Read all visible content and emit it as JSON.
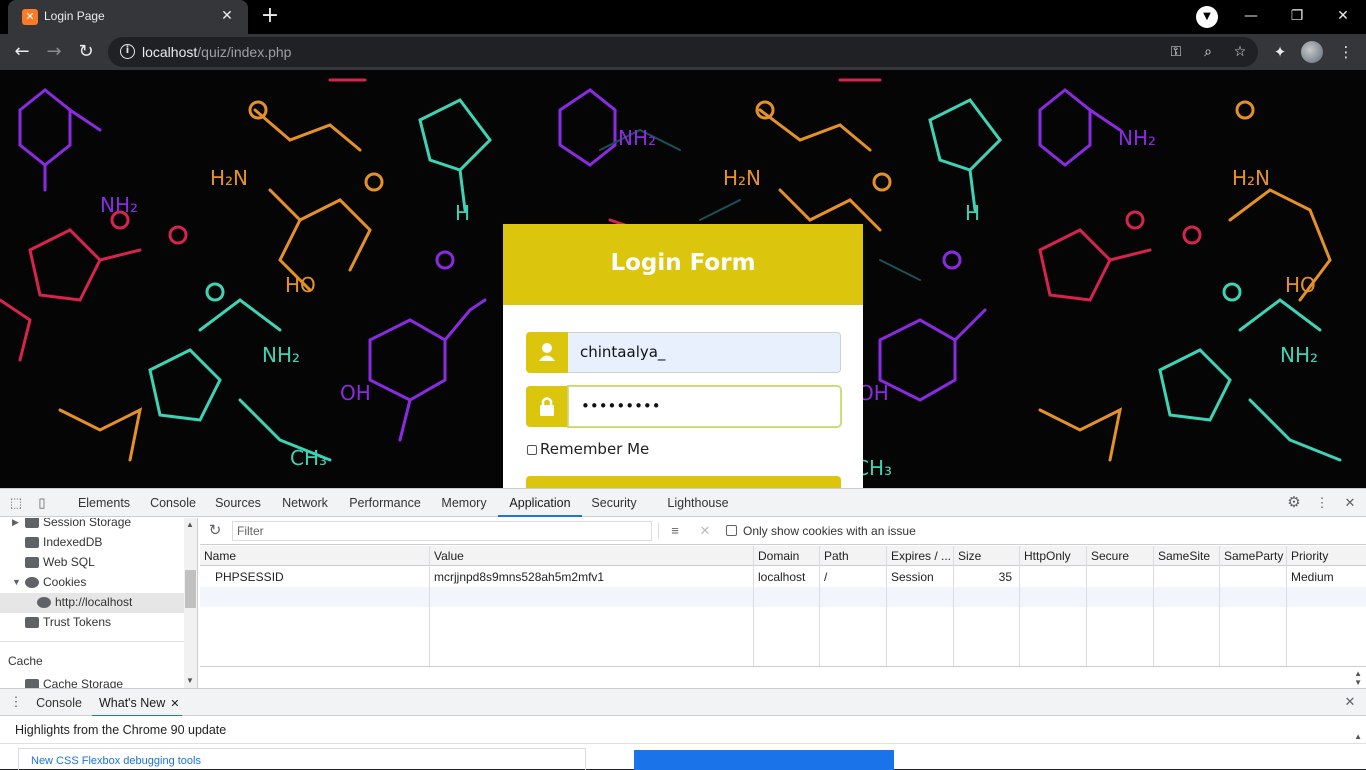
{
  "browser": {
    "tab_title": "Login Page",
    "tab_favicon_letter": "x",
    "url_host": "localhost",
    "url_path": "/quiz/index.php"
  },
  "page": {
    "login_title": "Login Form",
    "username_value": "chintaalya_",
    "password_value": "•••••••••",
    "remember_label": "Remember Me",
    "accent_color": "#dcc50d"
  },
  "devtools": {
    "tabs": [
      "Elements",
      "Console",
      "Sources",
      "Network",
      "Performance",
      "Memory",
      "Application",
      "Security",
      "Lighthouse"
    ],
    "active_tab": "Application",
    "sidebar": {
      "items": [
        "Session Storage",
        "IndexedDB",
        "Web SQL",
        "Cookies",
        "http://localhost",
        "Trust Tokens"
      ],
      "section_cache": "Cache",
      "item_cache_storage": "Cache Storage"
    },
    "filter_placeholder": "Filter",
    "only_issue_label": "Only show cookies with an issue",
    "columns": [
      "Name",
      "Value",
      "Domain",
      "Path",
      "Expires / ...",
      "Size",
      "HttpOnly",
      "Secure",
      "SameSite",
      "SameParty",
      "Priority"
    ],
    "cookie": {
      "name": "PHPSESSID",
      "value": "mcrjjnpd8s9mns528ah5m2mfv1",
      "domain": "localhost",
      "path": "/",
      "expires": "Session",
      "size": "35",
      "priority": "Medium"
    },
    "drawer_tabs": [
      "Console",
      "What's New"
    ],
    "highlights_text": "Highlights from the Chrome 90 update",
    "card_text": "New CSS Flexbox debugging tools"
  }
}
